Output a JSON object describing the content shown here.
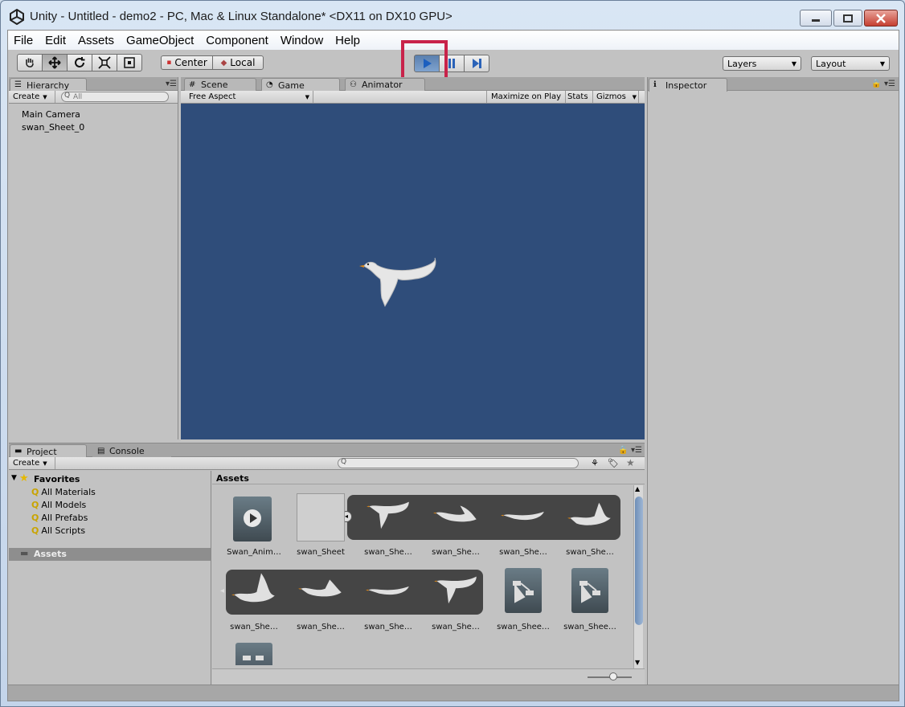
{
  "window": {
    "title": "Unity - Untitled - demo2 - PC, Mac & Linux Standalone* <DX11 on DX10 GPU>"
  },
  "menu": [
    "File",
    "Edit",
    "Assets",
    "GameObject",
    "Component",
    "Window",
    "Help"
  ],
  "toolbar": {
    "pivot": "Center",
    "space": "Local",
    "layers": "Layers",
    "layout": "Layout",
    "play_highlighted": true
  },
  "hierarchy": {
    "tab": "Hierarchy",
    "create": "Create",
    "search_placeholder": "All",
    "items": [
      "Main Camera",
      "swan_Sheet_0"
    ]
  },
  "center_tabs": {
    "scene": "Scene",
    "game": "Game",
    "animator": "Animator"
  },
  "game_view": {
    "aspect": "Free Aspect",
    "maximize": "Maximize on Play",
    "stats": "Stats",
    "gizmos": "Gizmos",
    "background_color": "#2f4d7a"
  },
  "inspector": {
    "tab": "Inspector"
  },
  "project": {
    "tab": "Project",
    "console_tab": "Console",
    "create": "Create",
    "favorites_label": "Favorites",
    "favorites": [
      "All Materials",
      "All Models",
      "All Prefabs",
      "All Scripts"
    ],
    "assets_root": "Assets",
    "breadcrumb": "Assets",
    "assets_row1": [
      "Swan_Anim…",
      "swan_Sheet",
      "swan_She…",
      "swan_She…",
      "swan_She…",
      "swan_She…"
    ],
    "assets_row2": [
      "swan_She…",
      "swan_She…",
      "swan_She…",
      "swan_She…",
      "swan_Shee…",
      "swan_Shee…"
    ]
  },
  "colors": {
    "editor_gray": "#c2c2c2",
    "highlight_box": "#c8234a"
  }
}
